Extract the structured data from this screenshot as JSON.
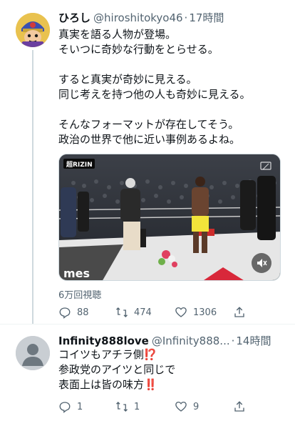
{
  "tweet1": {
    "display_name": "ひろし",
    "handle": "@hiroshitokyo46",
    "separator": "·",
    "time": "17時間",
    "body_lines": [
      "真実を語る人物が登場。",
      "そいつに奇妙な行動をとらせる。",
      "",
      "すると真実が奇妙に見える。",
      "同じ考えを持つ他の人も奇妙に見える。",
      "",
      "そんなフォーマットが存在してそう。",
      "政治の世界で他に近い事例あるよね。"
    ],
    "media": {
      "badge_text": "超RIZIN",
      "banner_text": "mes",
      "mute_icon": "speaker-muted-icon",
      "corner_icon": "broadcast-icon"
    },
    "views": "6万回視聴",
    "actions": {
      "reply_count": "88",
      "retweet_count": "474",
      "like_count": "1306"
    }
  },
  "tweet2": {
    "display_name": "Infinity888love",
    "handle": "@Infinity888...",
    "separator": "·",
    "time": "14時間",
    "body_lines": [
      "コイツもアチラ側⁉️",
      "参政党のアイツと同じで",
      "表面上は皆の味方‼️"
    ],
    "actions": {
      "reply_count": "1",
      "retweet_count": "1",
      "like_count": "9"
    }
  },
  "icons": {
    "reply": "reply-icon",
    "retweet": "retweet-icon",
    "like": "heart-icon",
    "share": "share-icon",
    "more": "more-icon"
  },
  "colors": {
    "text": "#0f1419",
    "secondary": "#536471",
    "thread_line": "#cfd9de",
    "divider": "#eff3f4"
  }
}
